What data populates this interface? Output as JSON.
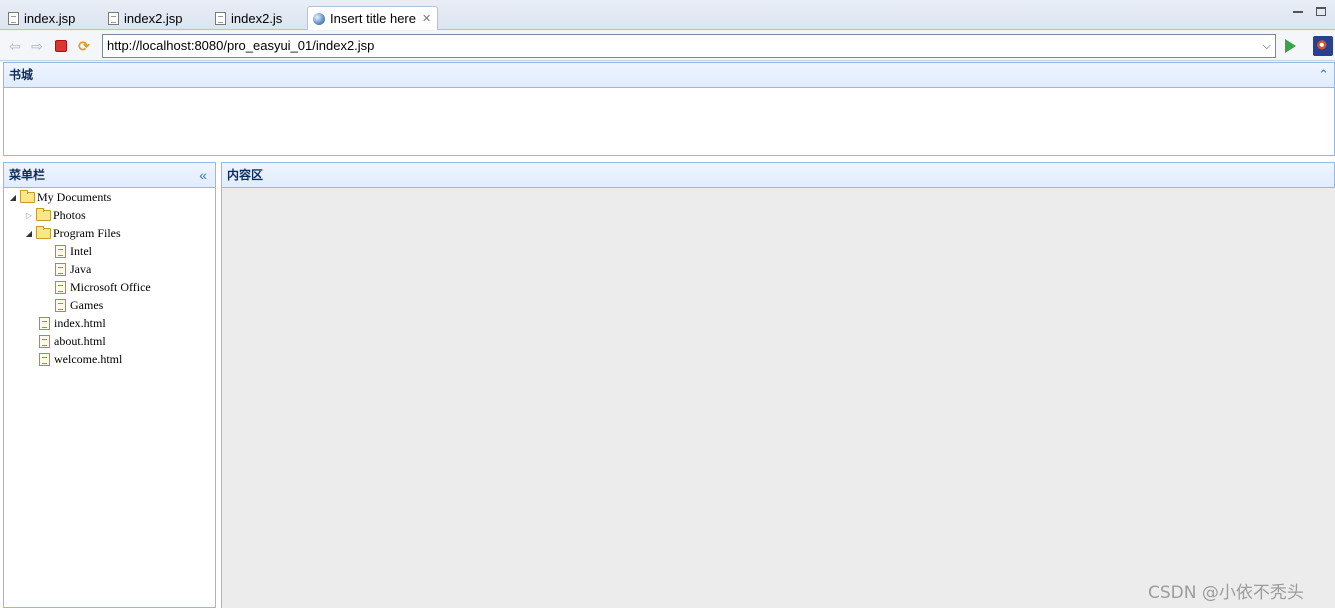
{
  "editor_tabs": [
    {
      "label": "index.jsp",
      "active": false
    },
    {
      "label": "index2.jsp",
      "active": false
    },
    {
      "label": "index2.js",
      "active": false
    },
    {
      "label": "Insert title here",
      "active": true
    }
  ],
  "browser": {
    "url": "http://localhost:8080/pro_easyui_01/index2.jsp"
  },
  "layout": {
    "north_title": "书城",
    "west_title": "菜单栏",
    "center_title": "内容区"
  },
  "tree": {
    "root": "My Documents",
    "photos": "Photos",
    "program_files": "Program Files",
    "pf_children": [
      "Intel",
      "Java",
      "Microsoft Office",
      "Games"
    ],
    "files": [
      "index.html",
      "about.html",
      "welcome.html"
    ]
  },
  "watermark": "CSDN @小依不秃头"
}
